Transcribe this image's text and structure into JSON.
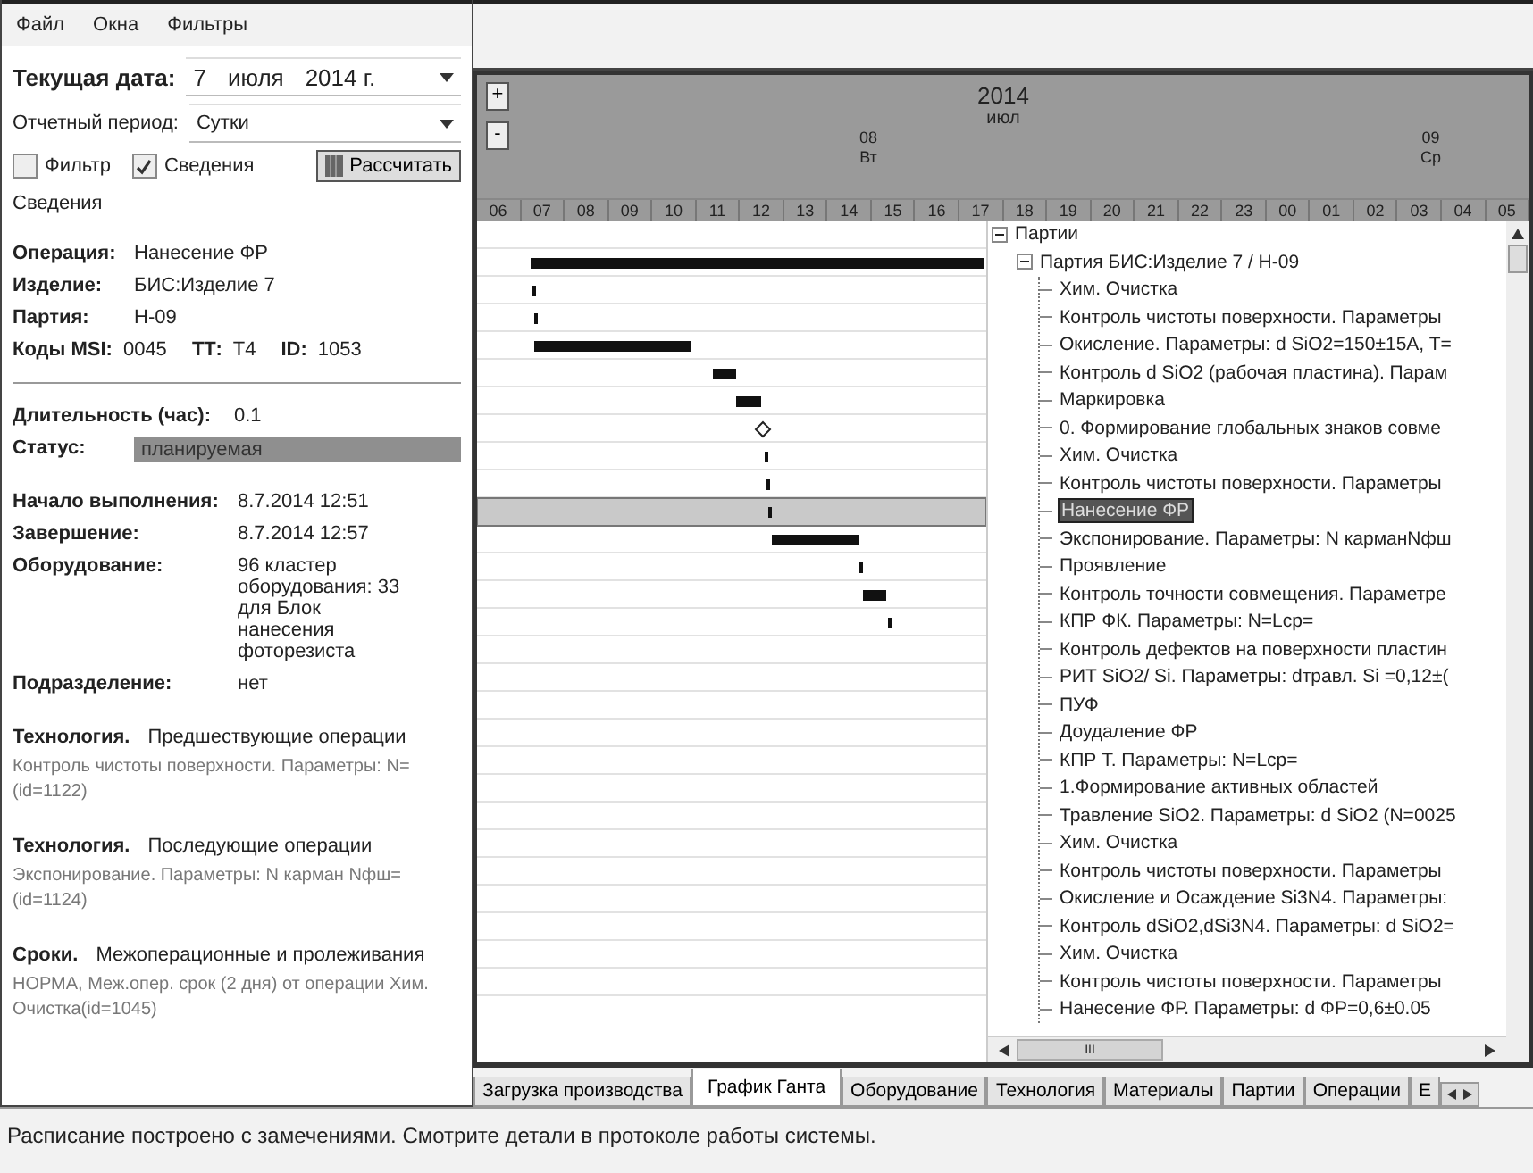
{
  "menu": [
    "Файл",
    "Окна",
    "Фильтры"
  ],
  "current_date": {
    "label": "Текущая дата:",
    "day": "7",
    "month": "июля",
    "year": "2014 г."
  },
  "period": {
    "label": "Отчетный период:",
    "value": "Сутки"
  },
  "checkboxes": [
    {
      "label": "Фильтр",
      "checked": false
    },
    {
      "label": "Сведения",
      "checked": true
    }
  ],
  "calculate_button": "Рассчитать",
  "info_title": "Сведения",
  "detail_groups": [
    {
      "rows": [
        {
          "kind": "field",
          "label": "Операция:",
          "value": "Нанесение ФР"
        },
        {
          "kind": "field",
          "label": "Изделие:",
          "value": "БИС:Изделие 7"
        },
        {
          "kind": "field",
          "label": "Партия:",
          "value": "Н-09"
        },
        {
          "kind": "codes",
          "parts": [
            {
              "label": "Коды MSI:",
              "value": "0045"
            },
            {
              "label": "ТТ:",
              "value": "Т4"
            },
            {
              "label": "ID:",
              "value": "1053"
            }
          ]
        }
      ]
    },
    {
      "rows": [
        {
          "kind": "field",
          "label": "Длительность (час):",
          "value": "0.1"
        },
        {
          "kind": "status",
          "label": "Статус:",
          "value": "планируемая"
        }
      ]
    },
    {
      "rows": [
        {
          "kind": "field",
          "label": "Начало выполнения:",
          "value": "8.7.2014 12:51"
        },
        {
          "kind": "field",
          "label": "Завершение:",
          "value": "8.7.2014 12:57"
        },
        {
          "kind": "field",
          "label": "Оборудование:",
          "value": "96 кластер оборудования: 33 для Блок нанесения фоторезиста"
        },
        {
          "kind": "field",
          "label": "Подразделение:",
          "value": "нет"
        }
      ]
    }
  ],
  "sections": [
    {
      "title": "Технология.",
      "subtitle": "Предшествующие операции",
      "text": "Контроль чистоты поверхности. Параметры: N= (id=1122)"
    },
    {
      "title": "Технология.",
      "subtitle": "Последующие операции",
      "text": "Экспонирование. Параметры: N карман Nфш= (id=1124)"
    },
    {
      "title": "Сроки.",
      "subtitle": "Межоперационные и пролеживания",
      "text": "НОРМА, Меж.опер. срок (2 дня) от операции Хим. Очистка(id=1045)"
    }
  ],
  "gantt": {
    "zoom_in": "+",
    "zoom_out": "-",
    "year": "2014",
    "month": "июл",
    "days": [
      {
        "date": "08",
        "weekday": "Вт"
      },
      {
        "date": "09",
        "weekday": "Ср"
      }
    ],
    "hours": [
      "06",
      "07",
      "08",
      "09",
      "10",
      "11",
      "12",
      "13",
      "14",
      "15",
      "16",
      "17",
      "18",
      "19",
      "20",
      "21",
      "22",
      "23",
      "00",
      "01",
      "02",
      "03",
      "04",
      "05"
    ]
  },
  "tree": {
    "label": "Партии",
    "expanded": true,
    "children": [
      {
        "label": "Партия  БИС:Изделие 7 / Н-09",
        "expanded": true,
        "children": [
          {
            "label": "Хим. Очистка",
            "selected": false
          },
          {
            "label": "Контроль чистоты поверхности. Параметры",
            "selected": false
          },
          {
            "label": "Окисление. Параметры: d SiO2=150±15A, T=",
            "selected": false
          },
          {
            "label": "Контроль d SiO2 (рабочая пластина). Парам",
            "selected": false
          },
          {
            "label": "Маркировка",
            "selected": false
          },
          {
            "label": "0. Формирование глобальных знаков совме",
            "selected": false
          },
          {
            "label": "Хим. Очистка",
            "selected": false
          },
          {
            "label": "Контроль чистоты поверхности. Параметры",
            "selected": false
          },
          {
            "label": "Нанесение ФР",
            "selected": true
          },
          {
            "label": "Экспонирование. Параметры: N карманNфш",
            "selected": false
          },
          {
            "label": "Проявление",
            "selected": false
          },
          {
            "label": "Контроль точности совмещения. Параметре",
            "selected": false
          },
          {
            "label": "КПР ФК. Параметры: N=Lcp=",
            "selected": false
          },
          {
            "label": "Контроль дефектов на поверхности пластин",
            "selected": false
          },
          {
            "label": "РИТ SiO2/ Si. Параметры: dтравл. Si =0,12±(",
            "selected": false
          },
          {
            "label": "ПУФ",
            "selected": false
          },
          {
            "label": "Доудаление ФР",
            "selected": false
          },
          {
            "label": "КПР Т. Параметры: N=Lcp=",
            "selected": false
          },
          {
            "label": "1.Формирование активных областей",
            "selected": false
          },
          {
            "label": "Травление SiO2. Параметры: d SiO2 (N=0025",
            "selected": false
          },
          {
            "label": "Хим. Очистка",
            "selected": false
          },
          {
            "label": "Контроль чистоты поверхности. Параметры",
            "selected": false
          },
          {
            "label": "Окисление и Осаждение Si3N4. Параметры:",
            "selected": false
          },
          {
            "label": "Контроль dSiO2,dSi3N4. Параметры: d SiO2=",
            "selected": false
          },
          {
            "label": "Хим. Очистка",
            "selected": false
          },
          {
            "label": "Контроль чистоты поверхности. Параметры",
            "selected": false
          },
          {
            "label": "Нанесение ФР. Параметры: d ФР=0,6±0.05",
            "selected": false
          }
        ]
      }
    ]
  },
  "scroll_thumb_grip": "III",
  "tabs": [
    {
      "label": "Загрузка производства",
      "selected": false
    },
    {
      "label": "График Ганта",
      "selected": true
    },
    {
      "label": "Оборудование",
      "selected": false
    },
    {
      "label": "Технология",
      "selected": false
    },
    {
      "label": "Материалы",
      "selected": false
    },
    {
      "label": "Партии",
      "selected": false
    },
    {
      "label": "Операции",
      "selected": false
    },
    {
      "label": "Е",
      "selected": false
    }
  ],
  "status_bar": "Расписание построено с замечениями. Смотрите детали в протоколе работы системы."
}
